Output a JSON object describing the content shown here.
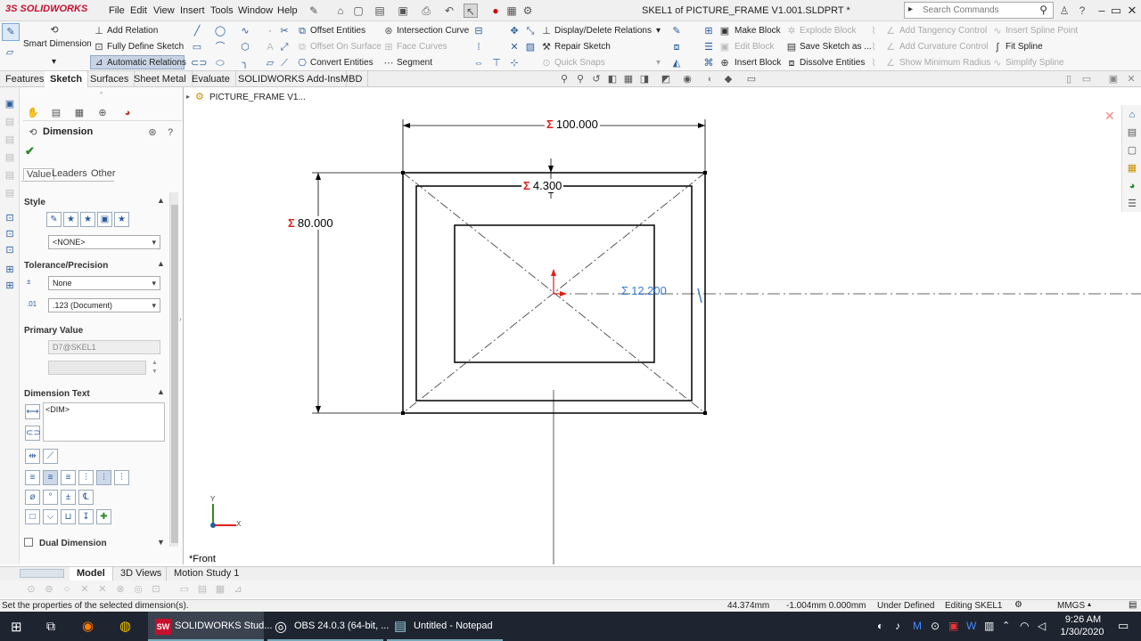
{
  "app": {
    "logo": "3S SOLIDWORKS",
    "title": "SKEL1 of PICTURE_FRAME V1.001.SLDPRT *"
  },
  "menu": [
    "File",
    "Edit",
    "View",
    "Insert",
    "Tools",
    "Window",
    "Help"
  ],
  "search": {
    "placeholder": "Search Commands"
  },
  "ribbon": {
    "smart_dimension": "Smart Dimension",
    "add_relation": "Add Relation",
    "fully_define": "Fully Define Sketch",
    "auto_relations": "Automatic Relations",
    "offset_entities": "Offset Entities",
    "offset_on_surface": "Offset On Surface",
    "convert_entities": "Convert Entities",
    "intersection_curve": "Intersection Curve",
    "face_curves": "Face Curves",
    "segment": "Segment",
    "display_delete": "Display/Delete Relations",
    "repair_sketch": "Repair Sketch",
    "quick_snaps": "Quick Snaps",
    "make_block": "Make Block",
    "edit_block": "Edit Block",
    "insert_block": "Insert Block",
    "explode_block": "Explode Block",
    "save_sketch_as": "Save Sketch as ...",
    "dissolve_entities": "Dissolve Entities",
    "add_tangency": "Add Tangency Control",
    "add_curvature": "Add Curvature Control",
    "show_min_radius": "Show Minimum Radius",
    "insert_spline_point": "Insert Spline Point",
    "fit_spline": "Fit Spline",
    "simplify_spline": "Simplify Spline"
  },
  "tabs": [
    "Features",
    "Sketch",
    "Surfaces",
    "Sheet Metal",
    "Evaluate",
    "SOLIDWORKS Add-Ins",
    "MBD"
  ],
  "tree": {
    "root": "PICTURE_FRAME V1..."
  },
  "pm": {
    "title": "Dimension",
    "subtabs": [
      "Value",
      "Leaders",
      "Other"
    ],
    "style_label": "Style",
    "style_value": "<NONE>",
    "tolerance_label": "Tolerance/Precision",
    "tolerance_value": "None",
    "precision_value": ".123 (Document)",
    "primary_value_label": "Primary Value",
    "primary_value_name": "D7@SKEL1",
    "dimension_text_label": "Dimension Text",
    "dimension_text_value": "<DIM>",
    "dual_dimension": "Dual Dimension"
  },
  "drawing": {
    "dim_width": "100.000",
    "dim_height": "80.000",
    "dim_offset": "4.300",
    "dim_active": "12.200",
    "sigma": "Σ",
    "view_label": "*Front",
    "axis_y": "Y",
    "axis_x": "X"
  },
  "bottom_tabs": [
    "Model",
    "3D Views",
    "Motion Study 1"
  ],
  "status": {
    "hint": "Set the properties of the selected dimension(s).",
    "x": "44.374mm",
    "y_z": "-1.004mm 0.000mm",
    "defined": "Under Defined",
    "editing": "Editing SKEL1",
    "units": "MMGS"
  },
  "taskbar": {
    "apps": [
      "SOLIDWORKS Stud...",
      "OBS 24.0.3 (64-bit, ...",
      "Untitled - Notepad"
    ],
    "time": "9:26 AM",
    "date": "1/30/2020"
  },
  "colors": {
    "accent": "#c8102e",
    "active_dim": "#3a7bd5",
    "dim_red": "#e0201a"
  }
}
